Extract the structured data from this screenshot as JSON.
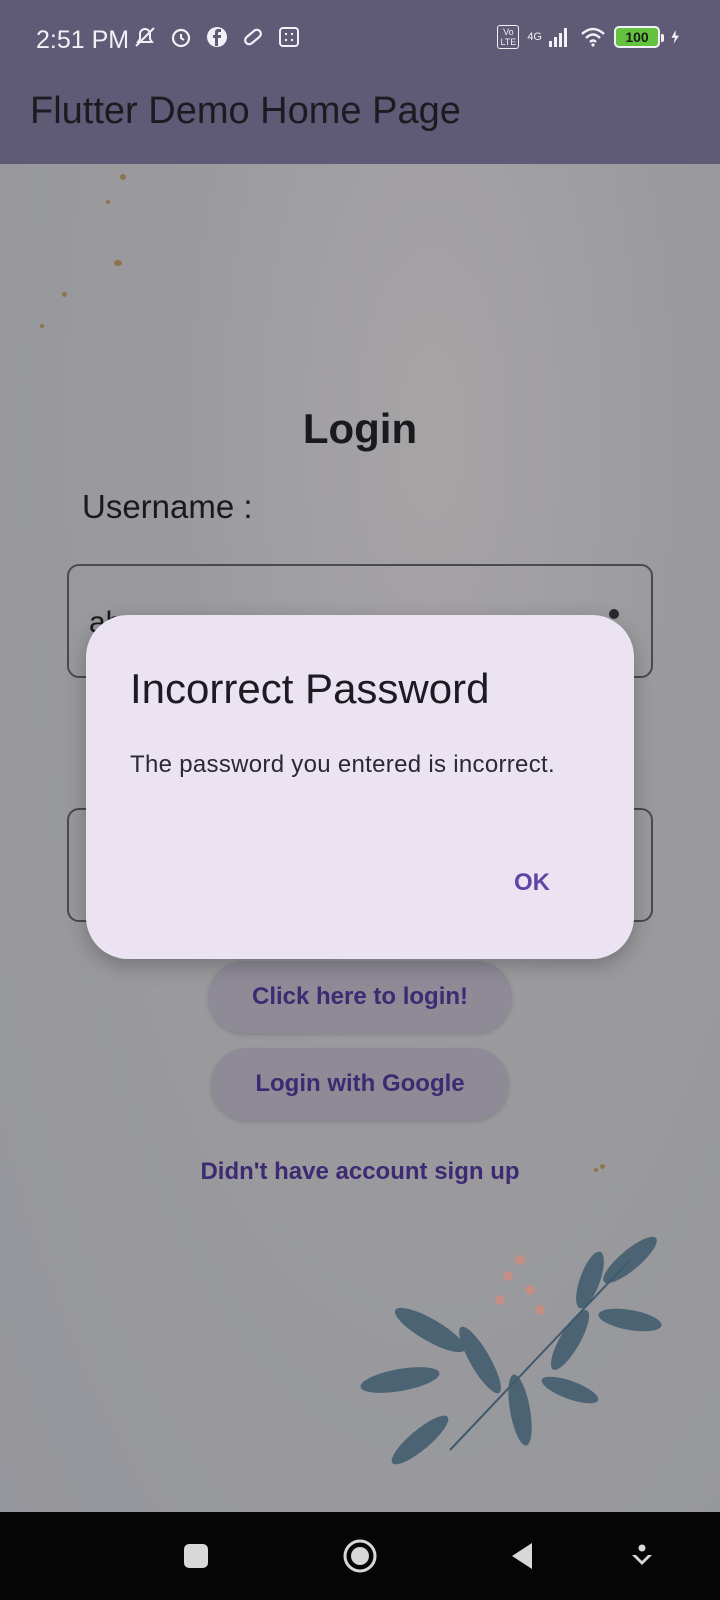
{
  "status_bar": {
    "time": "2:51 PM",
    "network": "4G",
    "battery": "100",
    "colors": {
      "bar": "#5f5a75",
      "battery_fill": "#63c33f"
    },
    "icons_left": [
      "mute-icon",
      "alarm-icon",
      "facebook-icon",
      "pill-icon",
      "calculator-icon"
    ],
    "icons_right": [
      "volte-icon",
      "signal-icon",
      "wifi-icon",
      "battery-icon",
      "charging-icon"
    ]
  },
  "app_bar": {
    "title": "Flutter Demo Home Page"
  },
  "login": {
    "title": "Login",
    "username_label": "Username :",
    "username_value": "ab",
    "login_button": "Click here to login!",
    "google_button": "Login with Google",
    "signup_link": "Didn't have account sign up"
  },
  "dialog": {
    "title": "Incorrect Password",
    "message": "The password you entered is incorrect.",
    "ok_button": "OK",
    "accent": "#5e45a6",
    "background": "#ebe3f2"
  },
  "nav_bar": {
    "icons": [
      "recent-apps-icon",
      "home-icon",
      "back-icon",
      "menu-down-icon"
    ]
  }
}
